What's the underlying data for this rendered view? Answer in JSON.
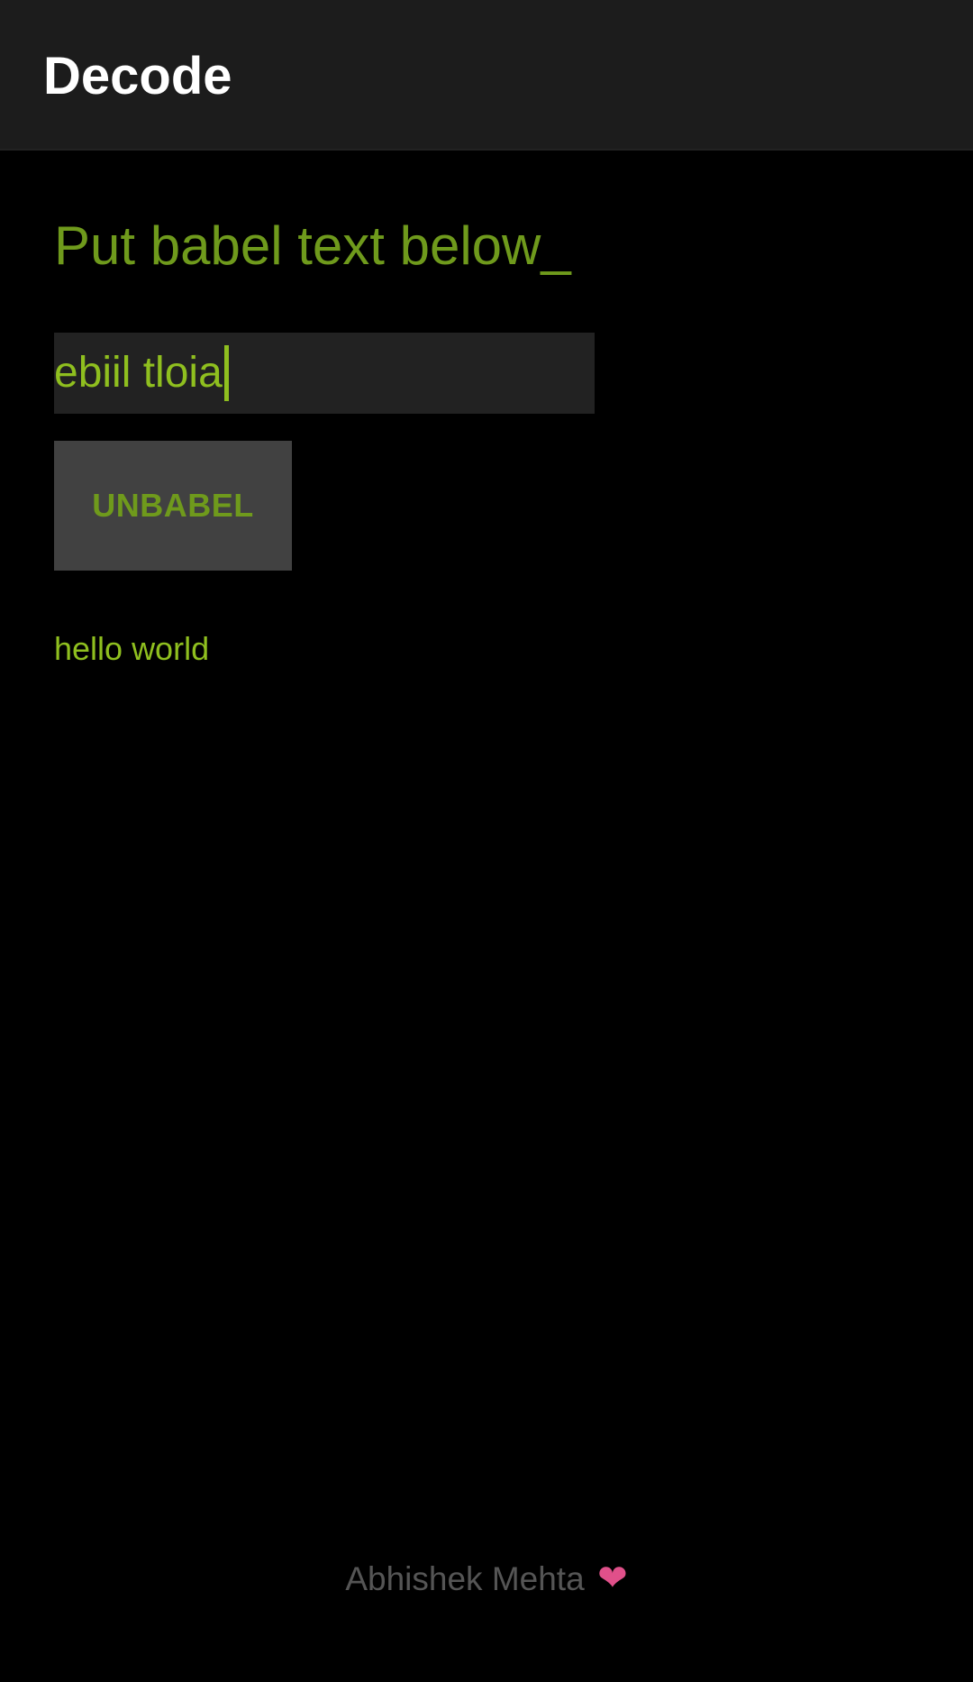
{
  "app_bar": {
    "title": "Decode"
  },
  "main": {
    "heading": "Put babel text below_",
    "input": {
      "value": "ebiil tloia"
    },
    "unbabel_button": {
      "label": "UNBABEL"
    },
    "output_text": "hello world"
  },
  "footer": {
    "author": "Abhishek Mehta",
    "icon": "heart-icon",
    "icon_glyph": "❤"
  },
  "colors": {
    "accent_green": "#6f9a1c",
    "text_green": "#8fbf1f",
    "app_bar_bg": "#1c1c1c",
    "button_bg": "#414141",
    "heart_pink": "#e0508a"
  }
}
